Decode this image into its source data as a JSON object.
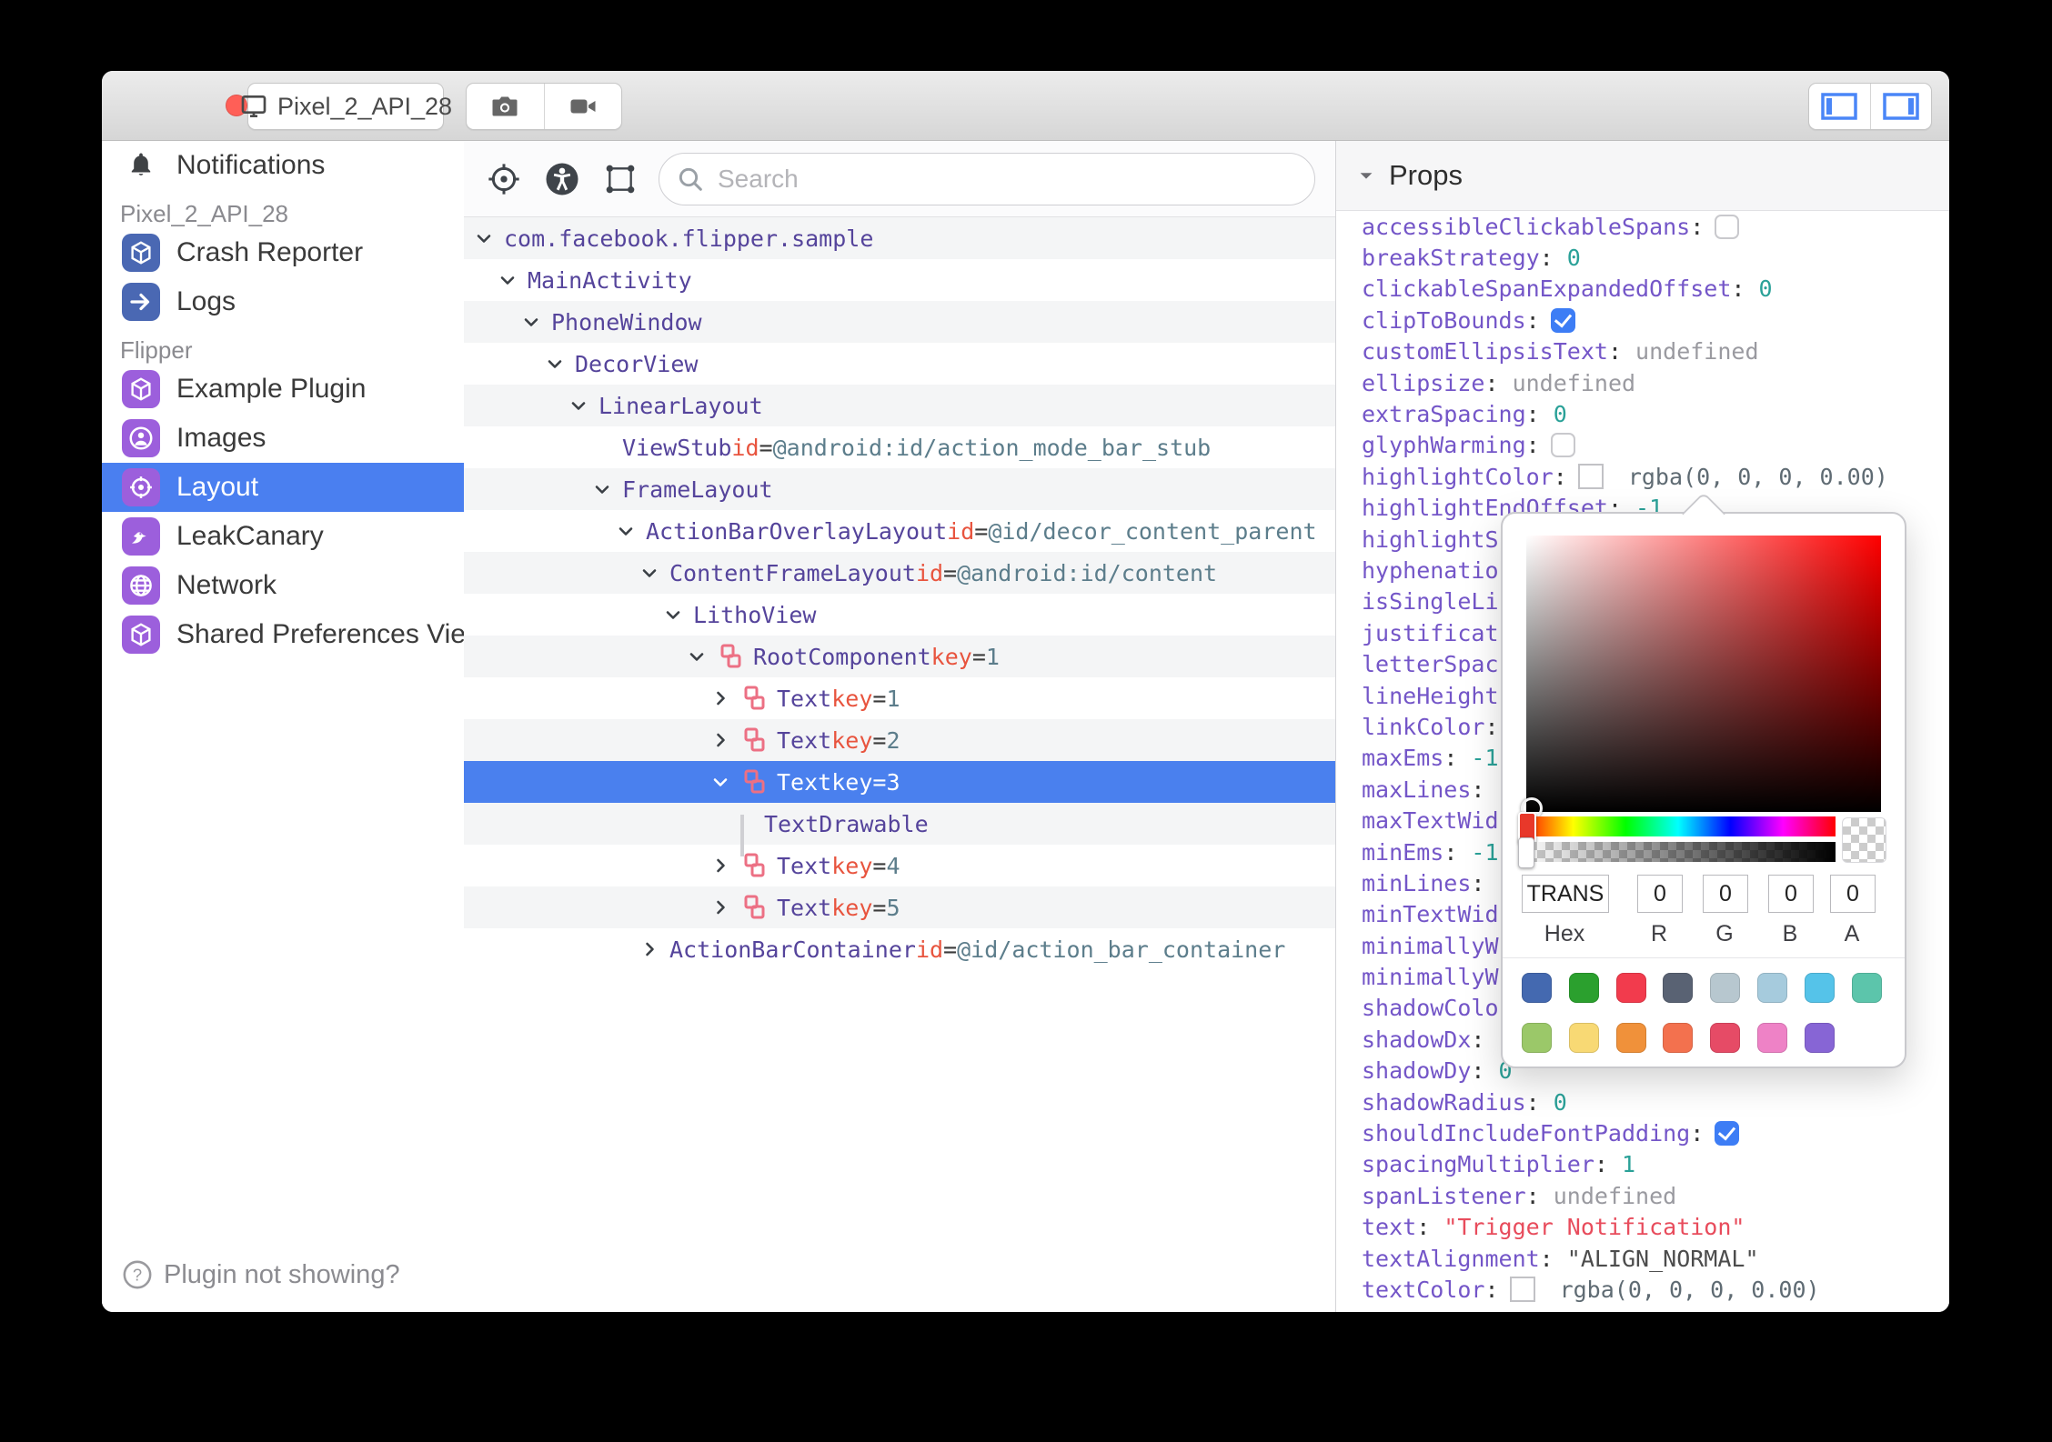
{
  "window": {
    "device_label": "Pixel_2_API_28",
    "traffic_lights": [
      "#ff5f57",
      "#febc2e",
      "#28c840"
    ]
  },
  "toolbar": {
    "search_placeholder": "Search"
  },
  "sidebar": {
    "items": [
      {
        "type": "plain",
        "label": "Notifications",
        "icon": "bell-icon"
      },
      {
        "type": "section",
        "label": "Pixel_2_API_28"
      },
      {
        "type": "plugin",
        "label": "Crash Reporter",
        "icon": "cube-icon",
        "tile": "#4a68b3"
      },
      {
        "type": "plugin",
        "label": "Logs",
        "icon": "arrow-right-icon",
        "tile": "#4a68b3"
      },
      {
        "type": "section",
        "label": "Flipper"
      },
      {
        "type": "plugin",
        "label": "Example Plugin",
        "icon": "cube-icon",
        "tile": "#9c5fdc"
      },
      {
        "type": "plugin",
        "label": "Images",
        "icon": "person-circle-icon",
        "tile": "#9c5fdc"
      },
      {
        "type": "plugin",
        "label": "Layout",
        "icon": "target-icon",
        "tile": "#9c5fdc",
        "selected": true
      },
      {
        "type": "plugin",
        "label": "LeakCanary",
        "icon": "bird-icon",
        "tile": "#9c5fdc"
      },
      {
        "type": "plugin",
        "label": "Network",
        "icon": "globe-icon",
        "tile": "#9c5fdc"
      },
      {
        "type": "plugin",
        "label": "Shared Preferences Viewer",
        "icon": "cube-icon",
        "tile": "#9c5fdc"
      }
    ],
    "help_label": "Plugin not showing?"
  },
  "tree": {
    "rows": [
      {
        "name": "com.facebook.flipper.sample",
        "level": 0,
        "chevron": "down"
      },
      {
        "name": "MainActivity",
        "level": 1,
        "chevron": "down"
      },
      {
        "name": "PhoneWindow",
        "level": 2,
        "chevron": "down"
      },
      {
        "name": "DecorView",
        "level": 3,
        "chevron": "down"
      },
      {
        "name": "LinearLayout",
        "level": 4,
        "chevron": "down"
      },
      {
        "name": "ViewStub",
        "level": 5,
        "chevron": "none",
        "kv": [
          {
            "k": "id",
            "v": "@android:id/action_mode_bar_stub"
          }
        ]
      },
      {
        "name": "FrameLayout",
        "level": 5,
        "chevron": "down"
      },
      {
        "name": "ActionBarOverlayLayout",
        "level": 6,
        "chevron": "down",
        "kv": [
          {
            "k": "id",
            "v": "@id/decor_content_parent"
          }
        ]
      },
      {
        "name": "ContentFrameLayout",
        "level": 7,
        "chevron": "down",
        "kv": [
          {
            "k": "id",
            "v": "@android:id/content"
          }
        ]
      },
      {
        "name": "LithoView",
        "level": 8,
        "chevron": "down"
      },
      {
        "name": "RootComponent",
        "level": 9,
        "chevron": "down",
        "litho": true,
        "kv": [
          {
            "k": "key",
            "v": "1"
          }
        ]
      },
      {
        "name": "Text",
        "level": 10,
        "chevron": "right",
        "litho": true,
        "kv": [
          {
            "k": "key",
            "v": "1"
          }
        ]
      },
      {
        "name": "Text",
        "level": 10,
        "chevron": "right",
        "litho": true,
        "kv": [
          {
            "k": "key",
            "v": "2"
          }
        ]
      },
      {
        "name": "Text",
        "level": 10,
        "chevron": "down",
        "litho": true,
        "kv": [
          {
            "k": "key",
            "v": "3"
          }
        ],
        "selected": true
      },
      {
        "name": "TextDrawable",
        "level": 11,
        "chevron": "bar"
      },
      {
        "name": "Text",
        "level": 10,
        "chevron": "right",
        "litho": true,
        "kv": [
          {
            "k": "key",
            "v": "4"
          }
        ]
      },
      {
        "name": "Text",
        "level": 10,
        "chevron": "right",
        "litho": true,
        "kv": [
          {
            "k": "key",
            "v": "5"
          }
        ]
      },
      {
        "name": "ActionBarContainer",
        "level": 7,
        "chevron": "right",
        "kv": [
          {
            "k": "id",
            "v": "@id/action_bar_container"
          }
        ]
      }
    ]
  },
  "props": {
    "title": "Props",
    "rows": [
      {
        "key": "accessibleClickableSpans",
        "colon": true,
        "vt": "uncheck"
      },
      {
        "key": "breakStrategy",
        "colon": true,
        "vt": "num",
        "val": "0"
      },
      {
        "key": "clickableSpanExpandedOffset",
        "colon": true,
        "vt": "num",
        "val": "0"
      },
      {
        "key": "clipToBounds",
        "colon": true,
        "vt": "check"
      },
      {
        "key": "customEllipsisText",
        "colon": true,
        "vt": "undef",
        "val": "undefined"
      },
      {
        "key": "ellipsize",
        "colon": true,
        "vt": "undef",
        "val": "undefined"
      },
      {
        "key": "extraSpacing",
        "colon": true,
        "vt": "num",
        "val": "0"
      },
      {
        "key": "glyphWarming",
        "colon": true,
        "vt": "uncheck"
      },
      {
        "key": "highlightColor",
        "colon": true,
        "vt": "colorval",
        "val": "rgba(0, 0, 0, 0.00)"
      },
      {
        "key": "highlightEndOffset",
        "colon": true,
        "vt": "num",
        "val": "-1"
      },
      {
        "key": "highlightS",
        "colon": false,
        "vt": "none"
      },
      {
        "key": "hyphenatio",
        "colon": false,
        "vt": "none"
      },
      {
        "key": "isSingleLi",
        "colon": false,
        "vt": "none"
      },
      {
        "key": "justificat",
        "colon": false,
        "vt": "none"
      },
      {
        "key": "letterSpac",
        "colon": false,
        "vt": "none"
      },
      {
        "key": "lineHeight",
        "colon": false,
        "vt": "none"
      },
      {
        "key": "linkColor",
        "colon": true,
        "vt": "none"
      },
      {
        "key": "maxEms",
        "colon": true,
        "vt": "num",
        "val": "-1"
      },
      {
        "key": "maxLines",
        "colon": true,
        "vt": "none"
      },
      {
        "key": "maxTextWid",
        "colon": false,
        "vt": "none"
      },
      {
        "key": "minEms",
        "colon": true,
        "vt": "num",
        "val": "-1"
      },
      {
        "key": "minLines",
        "colon": true,
        "vt": "none"
      },
      {
        "key": "minTextWid",
        "colon": false,
        "vt": "none"
      },
      {
        "key": "minimallyW",
        "colon": false,
        "vt": "none"
      },
      {
        "key": "minimallyW",
        "colon": false,
        "vt": "none"
      },
      {
        "key": "shadowColo",
        "colon": false,
        "vt": "none"
      },
      {
        "key": "shadowDx",
        "colon": true,
        "vt": "none"
      },
      {
        "key": "shadowDy",
        "colon": true,
        "vt": "num",
        "val": "0"
      },
      {
        "key": "shadowRadius",
        "colon": true,
        "vt": "num",
        "val": "0"
      },
      {
        "key": "shouldIncludeFontPadding",
        "colon": true,
        "vt": "check"
      },
      {
        "key": "spacingMultiplier",
        "colon": true,
        "vt": "num",
        "val": "1"
      },
      {
        "key": "spanListener",
        "colon": true,
        "vt": "undef",
        "val": "undefined"
      },
      {
        "key": "text",
        "colon": true,
        "vt": "str",
        "val": "\"Trigger Notification\""
      },
      {
        "key": "textAlignment",
        "colon": true,
        "vt": "darkstr",
        "val": "\"ALIGN_NORMAL\""
      },
      {
        "key": "textColor",
        "colon": true,
        "vt": "colorval",
        "val": "rgba(0, 0, 0, 0.00)"
      }
    ]
  },
  "picker": {
    "hex": "TRANS",
    "r": "0",
    "g": "0",
    "b": "0",
    "a": "0",
    "labels": [
      "Hex",
      "R",
      "G",
      "B",
      "A"
    ],
    "swatches_row1": [
      "#4469b0",
      "#2ba02e",
      "#f23b4d",
      "#596273",
      "#b7c7cf",
      "#a6cbdd",
      "#55c3e9",
      "#5cc5ab"
    ],
    "swatches_row2": [
      "#9bc869",
      "#f8d974",
      "#f0913a",
      "#f3714e",
      "#e64b66",
      "#ee82c6",
      "#8765d5"
    ]
  },
  "colors": {
    "selection_blue": "#4a80ee",
    "sidebar_selected": "#4a7ff0",
    "tree_name_purple": "#55449b",
    "prop_key_purple": "#7456c8",
    "keyword_red": "#e8543e",
    "value_slate": "#5c7d8b",
    "number_teal": "#2aa198",
    "string_red": "#e84c5c",
    "litho_salmon": "#ec7084"
  }
}
